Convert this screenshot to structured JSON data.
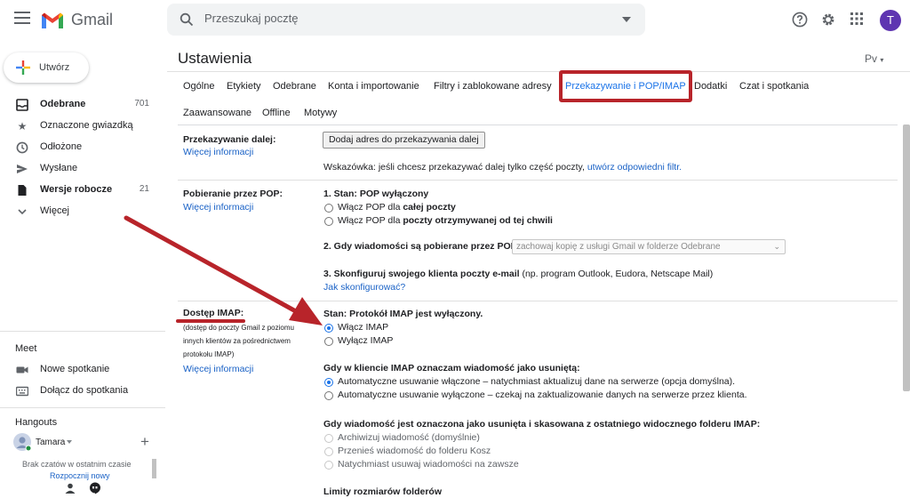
{
  "app": {
    "name": "Gmail"
  },
  "search": {
    "placeholder": "Przeszukaj pocztę"
  },
  "user": {
    "initial": "T",
    "name": "Tamara"
  },
  "compose": {
    "label": "Utwórz"
  },
  "sidebar": {
    "items": [
      {
        "label": "Odebrane",
        "count": "701",
        "bold": true,
        "icon": "inbox-icon"
      },
      {
        "label": "Oznaczone gwiazdką",
        "count": "",
        "icon": "star-icon"
      },
      {
        "label": "Odłożone",
        "count": "",
        "icon": "clock-icon"
      },
      {
        "label": "Wysłane",
        "count": "",
        "icon": "send-icon"
      },
      {
        "label": "Wersje robocze",
        "count": "21",
        "bold": true,
        "icon": "draft-icon"
      },
      {
        "label": "Więcej",
        "count": "",
        "icon": "chevron-down-icon"
      }
    ],
    "meet": {
      "title": "Meet",
      "items": [
        "Nowe spotkanie",
        "Dołącz do spotkania"
      ]
    },
    "hangouts": {
      "title": "Hangouts",
      "empty": "Brak czatów w ostatnim czasie",
      "start": "Rozpocznij nowy"
    }
  },
  "settings": {
    "title": "Ustawienia",
    "lang": "Pv",
    "tabs_row1": [
      "Ogólne",
      "Etykiety",
      "Odebrane",
      "Konta i importowanie",
      "Filtry i zablokowane adresy",
      "Przekazywanie i POP/IMAP",
      "Dodatki",
      "Czat i spotkania"
    ],
    "tabs_row2": [
      "Zaawansowane",
      "Offline",
      "Motywy"
    ],
    "forwarding": {
      "label": "Przekazywanie dalej:",
      "more": "Więcej informacji",
      "button": "Dodaj adres do przekazywania dalej",
      "hint_prefix": "Wskazówka: jeśli chcesz przekazywać dalej tylko część poczty,",
      "hint_link": "utwórz odpowiedni filtr."
    },
    "pop": {
      "label": "Pobieranie przez POP:",
      "more": "Więcej informacji",
      "status": "1. Stan: POP wyłączony",
      "opt1_prefix": "Włącz POP dla ",
      "opt1_bold": "całej poczty",
      "opt2_prefix": "Włącz POP dla ",
      "opt2_bold": "poczty otrzymywanej od tej chwili",
      "q2": "2. Gdy wiadomości są pobierane przez POP",
      "q2_select": "zachowaj kopię z usługi Gmail w folderze Odebrane",
      "q3_bold": "3. Skonfiguruj swojego klienta poczty e-mail",
      "q3_rest": " (np. program Outlook, Eudora, Netscape Mail)",
      "q3_link": "Jak skonfigurować?"
    },
    "imap": {
      "label": "Dostęp IMAP:",
      "desc": [
        "(dostęp do poczty Gmail z poziomu",
        "innych klientów za pośrednictwem",
        "protokołu IMAP)"
      ],
      "more": "Więcej informacji",
      "status": "Stan: Protokół IMAP jest wyłączony.",
      "enable": "Włącz IMAP",
      "disable": "Wyłącz IMAP",
      "delete_q": "Gdy w kliencie IMAP oznaczam wiadomość jako usuniętą:",
      "delete_opt1": "Automatyczne usuwanie włączone – natychmiast aktualizuj dane na serwerze (opcja domyślna).",
      "delete_opt2": "Automatyczne usuwanie wyłączone – czekaj na zaktualizowanie danych na serwerze przez klienta.",
      "expunge_q": "Gdy wiadomość jest oznaczona jako usunięta i skasowana z ostatniego widocznego folderu IMAP:",
      "expunge_opt1": "Archiwizuj wiadomość (domyślnie)",
      "expunge_opt2": "Przenieś wiadomość do folderu Kosz",
      "expunge_opt3": "Natychmiast usuwaj wiadomości na zawsze",
      "limits": "Limity rozmiarów folderów"
    }
  },
  "annotation": {
    "color": "#b8242a"
  }
}
